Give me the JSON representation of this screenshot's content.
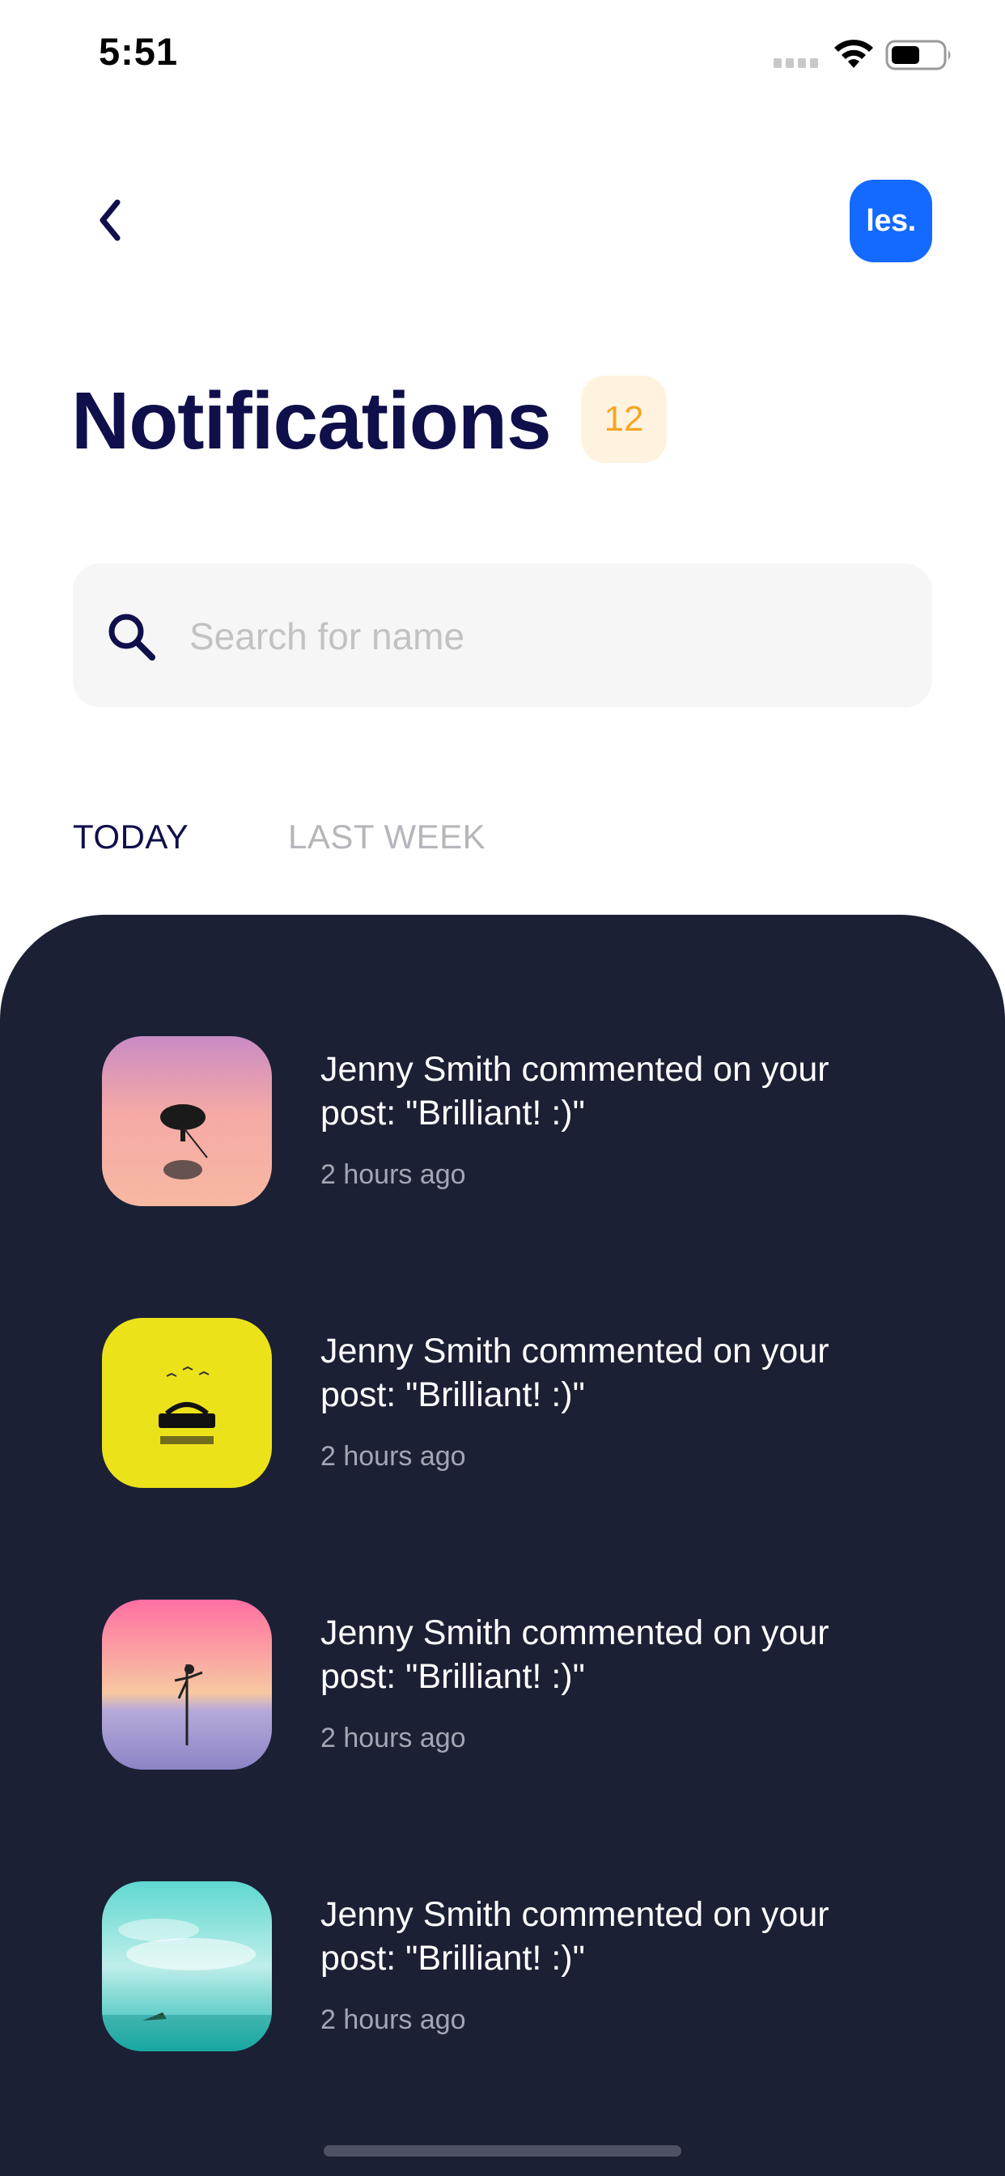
{
  "status_bar": {
    "time": "5:51"
  },
  "header": {
    "logo_text": "les."
  },
  "page": {
    "title": "Notifications",
    "count": "12"
  },
  "search": {
    "placeholder": "Search for name",
    "value": ""
  },
  "tabs": [
    {
      "label": "TODAY"
    },
    {
      "label": "LAST WEEK"
    }
  ],
  "notifications": [
    {
      "text": "Jenny Smith commented on your post: \"Brilliant! :)\"",
      "time": "2 hours ago"
    },
    {
      "text": "Jenny Smith commented on your post: \"Brilliant! :)\"",
      "time": "2 hours ago"
    },
    {
      "text": "Jenny Smith commented on your post: \"Brilliant! :)\"",
      "time": "2 hours ago"
    },
    {
      "text": "Jenny Smith commented on your post: \"Brilliant! :)\"",
      "time": "2 hours ago"
    }
  ],
  "colors": {
    "title": "#0f0f4b",
    "accent_blue": "#1469ff",
    "badge_bg": "#fff3df",
    "badge_text": "#f5a623",
    "panel_bg": "#1b2035"
  },
  "icons": {
    "back": "chevron-left-icon",
    "search": "search-icon",
    "wifi": "wifi-icon",
    "battery": "battery-icon",
    "signal": "signal-icon"
  }
}
